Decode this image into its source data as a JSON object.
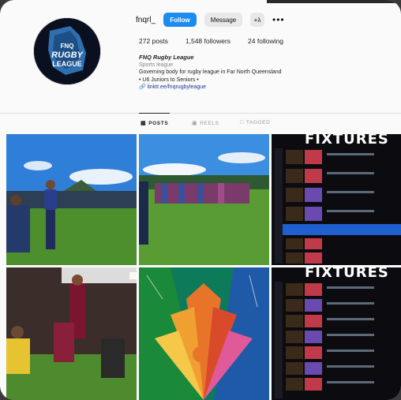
{
  "profile": {
    "username": "fnqrl_",
    "follow_label": "Follow",
    "message_label": "Message",
    "add_label": "+λ",
    "more_label": "•••",
    "stats": {
      "posts": "272 posts",
      "followers": "1,548 followers",
      "following": "24 following"
    },
    "display_name": "FNQ Rugby League",
    "category": "Sports league",
    "bio_line1": "Governing body for rugby league in Far North Queensland",
    "bio_line2": "• U6 Juniors to Seniors •",
    "link": "linktr.ee/fnqrugbyleague",
    "avatar_text_top": "FNQ",
    "avatar_text_mid": "RUGBY",
    "avatar_text_bot": "LEAGUE"
  },
  "tabs": [
    {
      "label": "POSTS",
      "icon": "grid-icon"
    },
    {
      "label": "REELS",
      "icon": "reels-icon"
    },
    {
      "label": "TAGGED",
      "icon": "tagged-icon"
    }
  ],
  "posts": [
    {
      "type": "photo",
      "scene": "team-huddle"
    },
    {
      "type": "photo",
      "scene": "team-lineup"
    },
    {
      "type": "graphic",
      "title": "FIXTURES"
    },
    {
      "type": "photo",
      "scene": "lineout"
    },
    {
      "type": "graphic",
      "scene": "indigenous-art"
    },
    {
      "type": "graphic",
      "title": "FIXTURES"
    }
  ],
  "colors": {
    "follow": "#1d8cf1",
    "link": "#1b3a8f",
    "maroon": "#7a1530",
    "grass": "#4c8f2c"
  }
}
